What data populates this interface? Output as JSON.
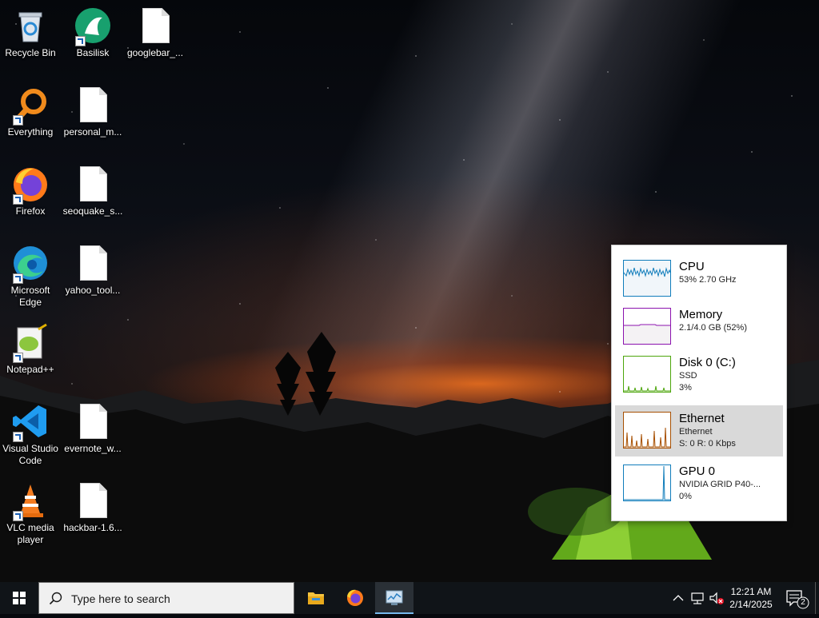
{
  "desktop": {
    "icons": [
      {
        "label": "Recycle Bin",
        "icon": "recycle-bin-icon"
      },
      {
        "label": "Basilisk",
        "icon": "basilisk-icon"
      },
      {
        "label": "googlebar_...",
        "icon": "file-icon"
      },
      {
        "label": "Everything",
        "icon": "everything-search-icon"
      },
      {
        "label": "personal_m...",
        "icon": "file-icon"
      },
      {
        "label": "Firefox",
        "icon": "firefox-icon"
      },
      {
        "label": "seoquake_s...",
        "icon": "file-icon"
      },
      {
        "label": "Microsoft Edge",
        "icon": "edge-icon"
      },
      {
        "label": "yahoo_tool...",
        "icon": "file-icon"
      },
      {
        "label": "Notepad++",
        "icon": "notepad-plus-plus-icon"
      },
      {
        "label": "Visual Studio Code",
        "icon": "vscode-icon"
      },
      {
        "label": "evernote_w...",
        "icon": "file-icon"
      },
      {
        "label": "VLC media player",
        "icon": "vlc-icon"
      },
      {
        "label": "hackbar-1.6...",
        "icon": "file-icon"
      }
    ]
  },
  "perf": {
    "items": [
      {
        "title": "CPU",
        "sub1": "53%  2.70 GHz",
        "sub2": "",
        "color": "#117dbb",
        "fill": "#f1f6fa"
      },
      {
        "title": "Memory",
        "sub1": "2.1/4.0 GB (52%)",
        "sub2": "",
        "color": "#8b12ae",
        "fill": "#f4f2f4"
      },
      {
        "title": "Disk 0 (C:)",
        "sub1": "SSD",
        "sub2": "3%",
        "color": "#4da60c",
        "fill": "#eff7ea"
      },
      {
        "title": "Ethernet",
        "sub1": "Ethernet",
        "sub2": "S: 0  R: 0 Kbps",
        "color": "#a74f01",
        "fill": "#fcf3eb"
      },
      {
        "title": "GPU 0",
        "sub1": "NVIDIA GRID P40-...",
        "sub2": "0%",
        "color": "#117dbb",
        "fill": "#f1f6fa"
      }
    ],
    "selected_index": 3
  },
  "taskbar": {
    "search_placeholder": "Type here to search",
    "apps": [
      {
        "name": "File Explorer",
        "icon": "file-explorer-icon"
      },
      {
        "name": "Firefox",
        "icon": "firefox-icon"
      },
      {
        "name": "Task Manager",
        "icon": "task-manager-icon",
        "active": true
      }
    ],
    "clock_time": "12:21 AM",
    "clock_date": "2/14/2025",
    "notification_count": "2"
  },
  "colors": {
    "taskbar_bg": "#101418",
    "accent": "#76b9ed",
    "selected_row": "#d9d9d9"
  }
}
